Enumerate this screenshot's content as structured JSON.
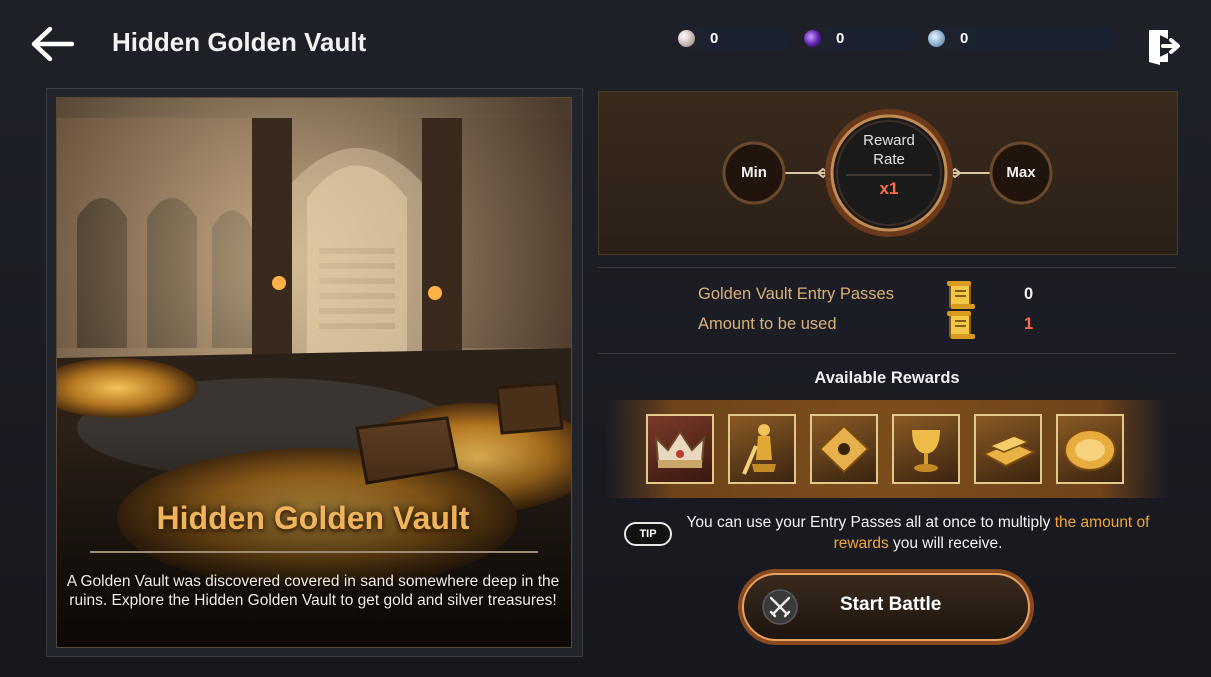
{
  "header": {
    "title": "Hidden Golden Vault",
    "currencies": [
      {
        "icon": "pearl-gem-icon",
        "value": "0"
      },
      {
        "icon": "purple-gem-icon",
        "value": "0"
      },
      {
        "icon": "silver-coin-icon",
        "value": "0"
      }
    ]
  },
  "vault": {
    "name": "Hidden Golden Vault",
    "description": "A Golden Vault was discovered covered in sand somewhere deep in the ruins. Explore the Hidden Golden Vault to get gold and silver treasures!"
  },
  "rate": {
    "min_label": "Min",
    "max_label": "Max",
    "title_line1": "Reward",
    "title_line2": "Rate",
    "value": "x1"
  },
  "passes": {
    "owned_label": "Golden Vault Entry Passes",
    "owned_value": "0",
    "use_label": "Amount to be used",
    "use_value": "1"
  },
  "rewards": {
    "title": "Available Rewards",
    "items": [
      "crown-icon",
      "golden-statue-icon",
      "gold-plate-icon",
      "golden-goblet-icon",
      "gold-bars-icon",
      "gold-dish-icon"
    ]
  },
  "tip": {
    "badge": "TIP",
    "text_before": "You can use your Entry Passes all at once to multiply ",
    "text_highlight": "the amount of rewards",
    "text_after": " you will receive."
  },
  "battle": {
    "label": "Start Battle"
  },
  "colors": {
    "accent": "#f0a53a",
    "gold_label": "#d9b07a",
    "use_value": "#ff6a4a",
    "title_glow": "#f0b45a"
  }
}
